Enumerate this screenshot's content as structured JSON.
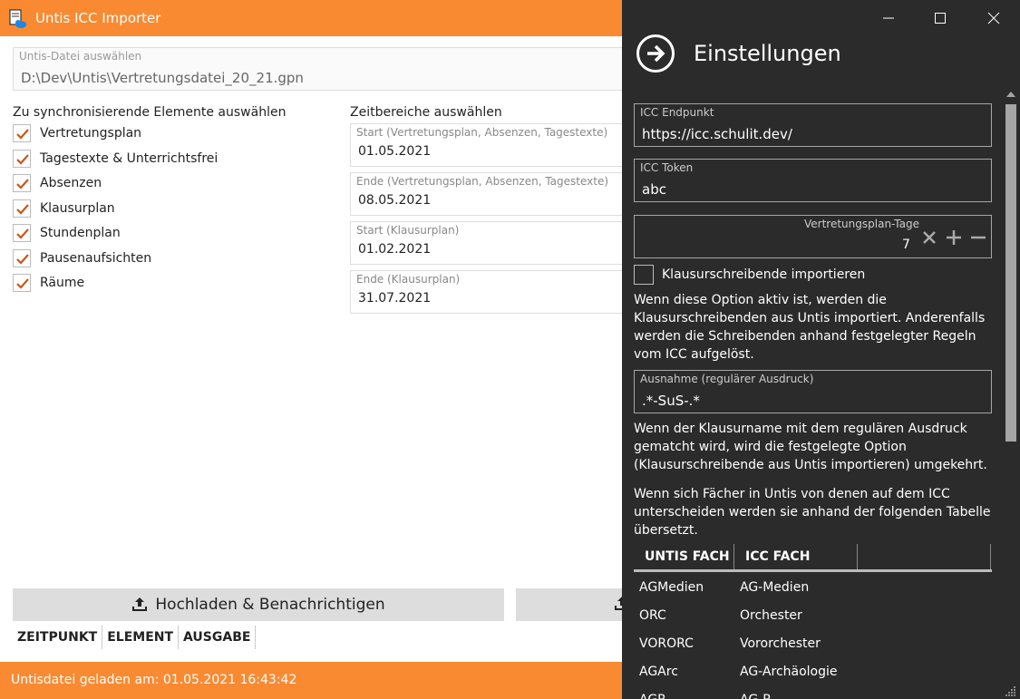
{
  "window": {
    "title": "Untis ICC Importer"
  },
  "main": {
    "file_label": "Untis-Datei auswählen",
    "file_value": "D:\\Dev\\Untis\\Vertretungsdatei_20_21.gpn",
    "elements_title": "Zu synchronisierende Elemente auswählen",
    "elements": [
      {
        "label": "Vertretungsplan",
        "checked": true
      },
      {
        "label": "Tagestexte & Unterrichtsfrei",
        "checked": true
      },
      {
        "label": "Absenzen",
        "checked": true
      },
      {
        "label": "Klausurplan",
        "checked": true
      },
      {
        "label": "Stundenplan",
        "checked": true
      },
      {
        "label": "Pausenaufsichten",
        "checked": true
      },
      {
        "label": "Räume",
        "checked": true
      }
    ],
    "time_title": "Zeitbereiche auswählen",
    "dates": [
      {
        "label": "Start (Vertretungsplan, Absenzen, Tagestexte)",
        "value": "01.05.2021"
      },
      {
        "label": "Ende (Vertretungsplan, Absenzen, Tagestexte)",
        "value": "08.05.2021"
      },
      {
        "label": "Start (Klausurplan)",
        "value": "01.02.2021"
      },
      {
        "label": "Ende (Klausurplan)",
        "value": "31.07.2021"
      }
    ],
    "upload_label": "Hochladen & Benachrichtigen",
    "log_columns": [
      "ZEITPUNKT",
      "ELEMENT",
      "AUSGABE"
    ]
  },
  "status": {
    "text": "Untisdatei geladen am: 01.05.2021 16:43:42"
  },
  "settings": {
    "title": "Einstellungen",
    "endpoint_label": "ICC Endpunkt",
    "endpoint_value": "https://icc.schulit.dev/",
    "token_label": "ICC Token",
    "token_value": "abc",
    "days_label": "Vertretungsplan-Tage",
    "days_value": "7",
    "exam_checkbox_label": "Klausurschreibende importieren",
    "exam_checkbox_checked": false,
    "exam_description": "Wenn diese Option aktiv ist, werden die Klausurschreibenden aus Untis importiert. Anderenfalls werden die Schreibenden anhand festgelegter Regeln vom ICC aufgelöst.",
    "exception_label": "Ausnahme (regulärer Ausdruck)",
    "exception_value": ".*-SuS-.*",
    "exception_description": "Wenn der Klausurname mit dem regulären Ausdruck gematcht wird, wird die festgelegte Option (Klausurschreibende aus Untis importieren) umgekehrt.",
    "subjects_description": "Wenn sich Fächer in Untis von denen auf dem ICC unterscheiden werden sie anhand der folgenden Tabelle übersetzt.",
    "table_headers": [
      "UNTIS FACH",
      "ICC FACH"
    ],
    "subjects": [
      {
        "untis": "AGMedien",
        "icc": "AG-Medien"
      },
      {
        "untis": "ORC",
        "icc": "Orchester"
      },
      {
        "untis": "VORORC",
        "icc": "Vororchester"
      },
      {
        "untis": "AGArc",
        "icc": "AG-Archäologie"
      },
      {
        "untis": "AGR",
        "icc": "AG-R"
      }
    ]
  },
  "colors": {
    "accent": "#f98a32",
    "flyout_bg": "#2b2b2b"
  }
}
